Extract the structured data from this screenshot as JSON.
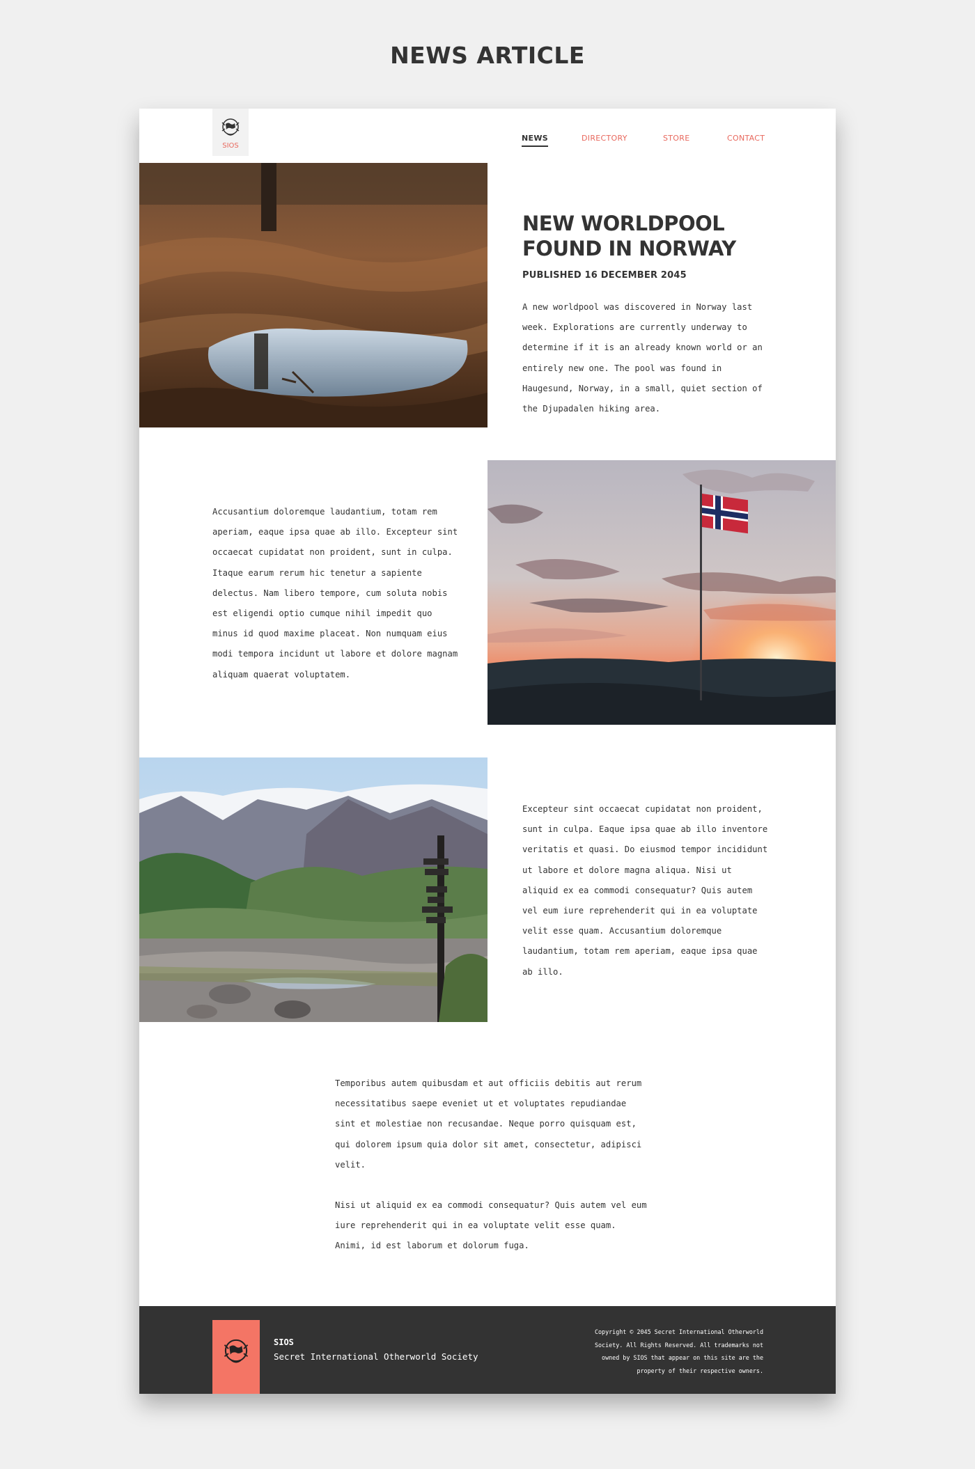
{
  "page": {
    "title": "NEWS ARTICLE"
  },
  "brand": {
    "logo_text": "SIOS",
    "name": "SIOS",
    "tagline": "Secret International Otherworld Society"
  },
  "nav": {
    "items": [
      {
        "label": "NEWS",
        "active": true
      },
      {
        "label": "DIRECTORY",
        "active": false
      },
      {
        "label": "STORE",
        "active": false
      },
      {
        "label": "CONTACT",
        "active": false
      }
    ]
  },
  "article": {
    "headline": "NEW WORLDPOOL FOUND IN NORWAY",
    "published": "PUBLISHED 16 DECEMBER 2045",
    "intro": "A new worldpool was discovered in Norway last week. Explorations are currently underway to determine if it is an already known world or an entirely new one. The pool was found in Haugesund, Norway, in a small, quiet section of the Djupadalen hiking area.",
    "para2": "Accusantium doloremque laudantium, totam rem aperiam, eaque ipsa quae ab illo. Excepteur sint occaecat cupidatat non proident, sunt in culpa. Itaque earum rerum hic tenetur a sapiente delectus. Nam libero tempore, cum soluta nobis est eligendi optio cumque nihil impedit quo minus id quod maxime placeat. Non numquam eius modi tempora incidunt ut labore et dolore magnam aliquam quaerat voluptatem.",
    "para3": "Excepteur sint occaecat cupidatat non proident, sunt in culpa. Eaque ipsa quae ab illo inventore veritatis et quasi. Do eiusmod tempor incididunt ut labore et dolore magna aliqua. Nisi ut aliquid ex ea commodi consequatur? Quis autem vel eum iure reprehenderit qui in ea voluptate velit esse quam. Accusantium doloremque laudantium, totam rem aperiam, eaque ipsa quae ab illo.",
    "para4": "Temporibus autem quibusdam et aut officiis debitis aut rerum necessitatibus saepe eveniet ut et voluptates repudiandae sint et molestiae non recusandae. Neque porro quisquam est, qui dolorem ipsum quia dolor sit amet, consectetur, adipisci velit.",
    "para5": "Nisi ut aliquid ex ea commodi consequatur? Quis autem vel eum iure reprehenderit qui in ea voluptate velit esse quam. Animi, id est laborum et dolorum fuga."
  },
  "footer": {
    "copyright": "Copyright © 2045 Secret International Otherworld Society. All Rights Reserved. All trademarks not owned by SIOS that appear on this site are the property of their respective owners."
  },
  "colors": {
    "accent": "#f47565",
    "nav_link": "#e8685d",
    "footer_bg": "#333333",
    "text": "#333333"
  }
}
